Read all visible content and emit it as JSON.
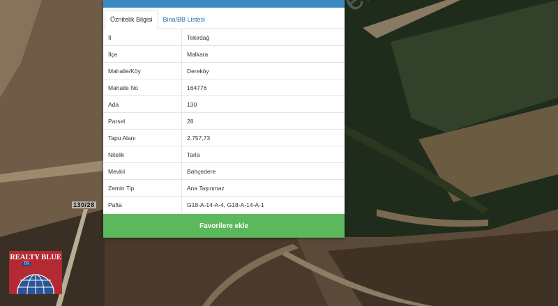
{
  "tabs": [
    {
      "label": "Öznitelik Bilgisi",
      "active": true
    },
    {
      "label": "Bina/BB Listesi",
      "active": false
    }
  ],
  "rows": [
    {
      "key": "İl",
      "value": "Tekirdağ"
    },
    {
      "key": "İlçe",
      "value": "Malkara"
    },
    {
      "key": "Mahalle/Köy",
      "value": "Dereköy"
    },
    {
      "key": "Mahalle No",
      "value": "164776"
    },
    {
      "key": "Ada",
      "value": "130"
    },
    {
      "key": "Parsel",
      "value": "28"
    },
    {
      "key": "Tapu Alanı",
      "value": "2.757,73"
    },
    {
      "key": "Nitelik",
      "value": "Tarla"
    },
    {
      "key": "Mevkii",
      "value": "Bahçedere"
    },
    {
      "key": "Zemin Tip",
      "value": "Ana Taşınmaz"
    },
    {
      "key": "Pafta",
      "value": "G18-A-14-A-4, G18-A-14-A-1"
    }
  ],
  "favorite_button": "Favorilere ekle",
  "map": {
    "parcel_label": "130/28",
    "watermark": "sahibinden.com / emlakjet.com"
  },
  "logo": {
    "name": "REALTY BLUE",
    "sub": "TR"
  },
  "colors": {
    "header": "#3b8ac4",
    "button": "#5cb85c",
    "link": "#2a72b5",
    "logo_bg": "#b42a33"
  }
}
